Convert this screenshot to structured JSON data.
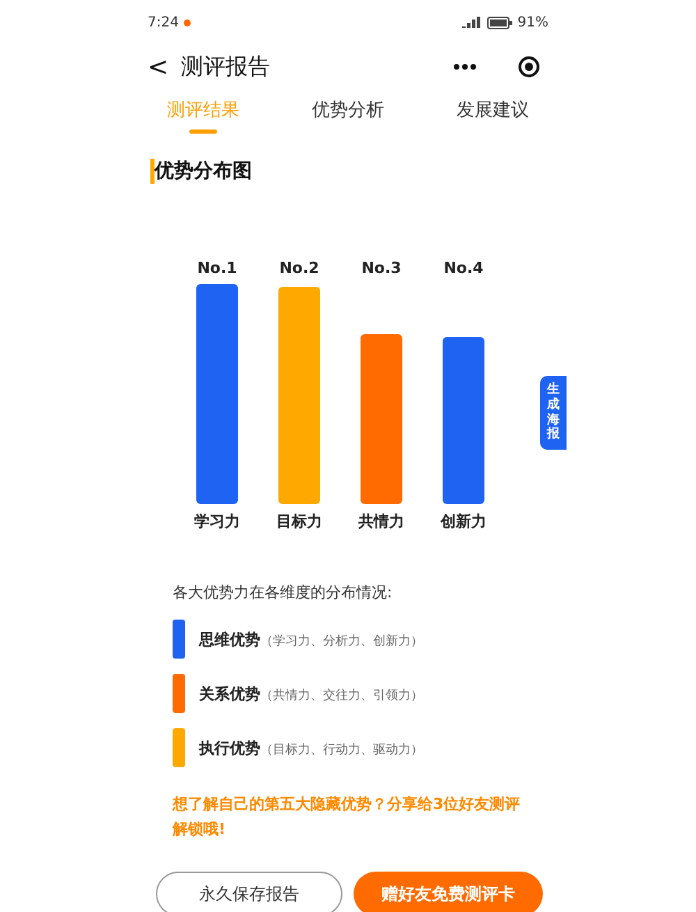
{
  "status_bar": {
    "time": "7:24",
    "battery": "91%"
  },
  "header": {
    "title": "测评报告",
    "back": "<"
  },
  "tabs": [
    {
      "label": "测评结果",
      "selected": true
    },
    {
      "label": "优势分析",
      "selected": false
    },
    {
      "label": "发展建议",
      "selected": false
    }
  ],
  "section_title": "优势分布图",
  "bars": [
    {
      "rank": "No.1",
      "category": "学习力",
      "color": "#1f63f2"
    },
    {
      "rank": "No.2",
      "category": "目标力",
      "color": "#ffa800"
    },
    {
      "rank": "No.3",
      "category": "共情力",
      "color": "#ff6b00"
    },
    {
      "rank": "No.4",
      "category": "创新力",
      "color": "#1f63f2"
    }
  ],
  "poster_button": "生成海报",
  "legend_intro": "各大优势力在各维度的分布情况:",
  "legend": [
    {
      "name": "思维优势",
      "detail": "（学习力、分析力、创新力）",
      "color": "#1f63f2"
    },
    {
      "name": "关系优势",
      "detail": "（共情力、交往力、引领力）",
      "color": "#ff6b00"
    },
    {
      "name": "执行优势",
      "detail": "（目标力、行动力、驱动力）",
      "color": "#ffa800"
    }
  ],
  "promo": "想了解自己的第五大隐藏优势？分享给3位好友测评解锁哦!",
  "buttons": [
    {
      "label": "永久保存报告",
      "kind": "outline"
    },
    {
      "label": "赠好友免费测评卡",
      "kind": "primary"
    }
  ]
}
